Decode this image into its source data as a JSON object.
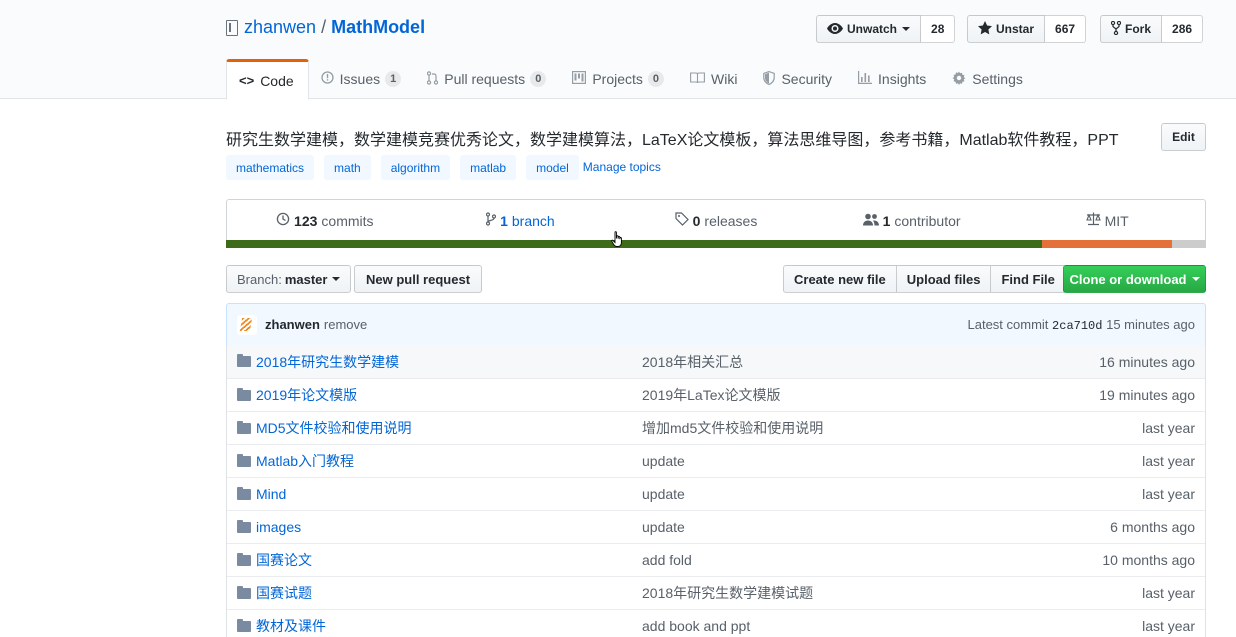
{
  "repo": {
    "owner": "zhanwen",
    "separator": "/",
    "name": "MathModel"
  },
  "actions": {
    "watch": {
      "label": "Unwatch",
      "icon": "eye-icon",
      "count": "28"
    },
    "star": {
      "label": "Unstar",
      "icon": "star-icon",
      "count": "667"
    },
    "fork": {
      "label": "Fork",
      "icon": "fork-icon",
      "count": "286"
    }
  },
  "tabs": [
    {
      "label": "Code",
      "icon": "code-icon",
      "counter": ""
    },
    {
      "label": "Issues",
      "icon": "issue-icon",
      "counter": "1"
    },
    {
      "label": "Pull requests",
      "icon": "pull-request-icon",
      "counter": "0"
    },
    {
      "label": "Projects",
      "icon": "project-icon",
      "counter": "0"
    },
    {
      "label": "Wiki",
      "icon": "book-icon",
      "counter": ""
    },
    {
      "label": "Security",
      "icon": "shield-icon",
      "counter": ""
    },
    {
      "label": "Insights",
      "icon": "graph-icon",
      "counter": ""
    },
    {
      "label": "Settings",
      "icon": "gear-icon",
      "counter": ""
    }
  ],
  "description": "研究生数学建模，数学建模竞赛优秀论文，数学建模算法，LaTeX论文模板，算法思维导图，参考书籍，Matlab软件教程，PPT",
  "edit_label": "Edit",
  "topics": [
    "mathematics",
    "math",
    "algorithm",
    "matlab",
    "model"
  ],
  "manage_topics": "Manage topics",
  "summary": {
    "commits": {
      "count": "123",
      "label": "commits"
    },
    "branches": {
      "count": "1",
      "label": "branch"
    },
    "releases": {
      "count": "0",
      "label": "releases"
    },
    "contributors": {
      "count": "1",
      "label": "contributor"
    },
    "license": "MIT"
  },
  "languages": [
    {
      "share": 0.833,
      "color": "#3e6b1a"
    },
    {
      "share": 0.132,
      "color": "#e4703a"
    },
    {
      "share": 0.035,
      "color": "#cccccc"
    }
  ],
  "branch_button": {
    "label": "Branch:",
    "value": "master"
  },
  "new_pr": "New pull request",
  "file_buttons": [
    "Create new file",
    "Upload files",
    "Find File"
  ],
  "clone": "Clone or download",
  "commit": {
    "author": "zhanwen",
    "message": "remove",
    "latest_label": "Latest commit",
    "sha": "2ca710d",
    "age": "15 minutes ago"
  },
  "files": [
    {
      "name": "2018年研究生数学建模",
      "message": "2018年相关汇总",
      "age": "16 minutes ago"
    },
    {
      "name": "2019年论文模版",
      "message": "2019年LaTex论文模版",
      "age": "19 minutes ago"
    },
    {
      "name": "MD5文件校验和使用说明",
      "message": "增加md5文件校验和使用说明",
      "age": "last year"
    },
    {
      "name": "Matlab入门教程",
      "message": "update",
      "age": "last year"
    },
    {
      "name": "Mind",
      "message": "update",
      "age": "last year"
    },
    {
      "name": "images",
      "message": "update",
      "age": "6 months ago"
    },
    {
      "name": "国赛论文",
      "message": "add fold",
      "age": "10 months ago"
    },
    {
      "name": "国赛试题",
      "message": "2018年研究生数学建模试题",
      "age": "last year"
    },
    {
      "name": "教材及课件",
      "message": "add book and ppt",
      "age": "last year"
    }
  ]
}
